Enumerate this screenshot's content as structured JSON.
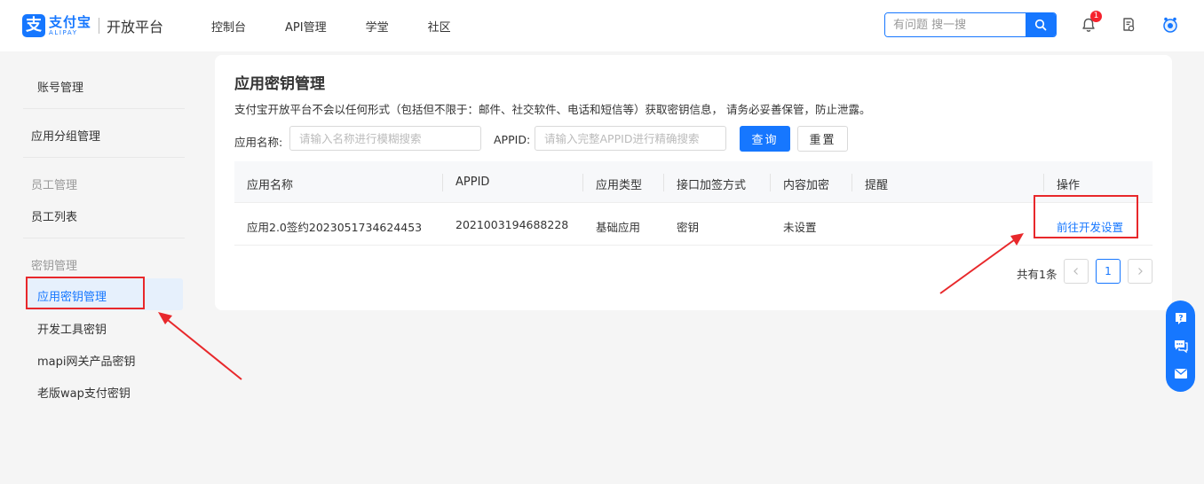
{
  "header": {
    "logo_cn": "支付宝",
    "logo_en": "ALIPAY",
    "platform": "开放平台",
    "nav": [
      "控制台",
      "API管理",
      "学堂",
      "社区"
    ],
    "search_placeholder": "有问题 搜一搜",
    "notification_count": "1",
    "brand_color": "#1677ff"
  },
  "sidebar": {
    "account": "账号管理",
    "app_group": "应用分组管理",
    "staff_group": "员工管理",
    "staff_list": "员工列表",
    "key_group": "密钥管理",
    "app_key": "应用密钥管理",
    "dev_tool_key": "开发工具密钥",
    "mapi_key": "mapi网关产品密钥",
    "wap_key": "老版wap支付密钥"
  },
  "main": {
    "title": "应用密钥管理",
    "description": "支付宝开放平台不会以任何形式（包括但不限于：邮件、社交软件、电话和短信等）获取密钥信息，  请务必妥善保管，防止泄露。",
    "filter": {
      "name_label": "应用名称:",
      "name_placeholder": "请输入名称进行模糊搜索",
      "appid_label": "APPID:",
      "appid_placeholder": "请输入完整APPID进行精确搜索",
      "search_button": "查询",
      "reset_button": "重置"
    },
    "table": {
      "columns": [
        "应用名称",
        "APPID",
        "应用类型",
        "接口加签方式",
        "内容加密",
        "提醒",
        "操作"
      ],
      "rows": [
        {
          "name": "应用2.0签约2023051734624453",
          "appid": "2021003194688228",
          "type": "基础应用",
          "sign_method": "密钥",
          "encryption": "未设置",
          "reminder": "",
          "action": "前往开发设置"
        }
      ]
    },
    "pagination": {
      "total": "共有1条",
      "current_page": "1"
    }
  },
  "annotation_color": "#e8282b"
}
